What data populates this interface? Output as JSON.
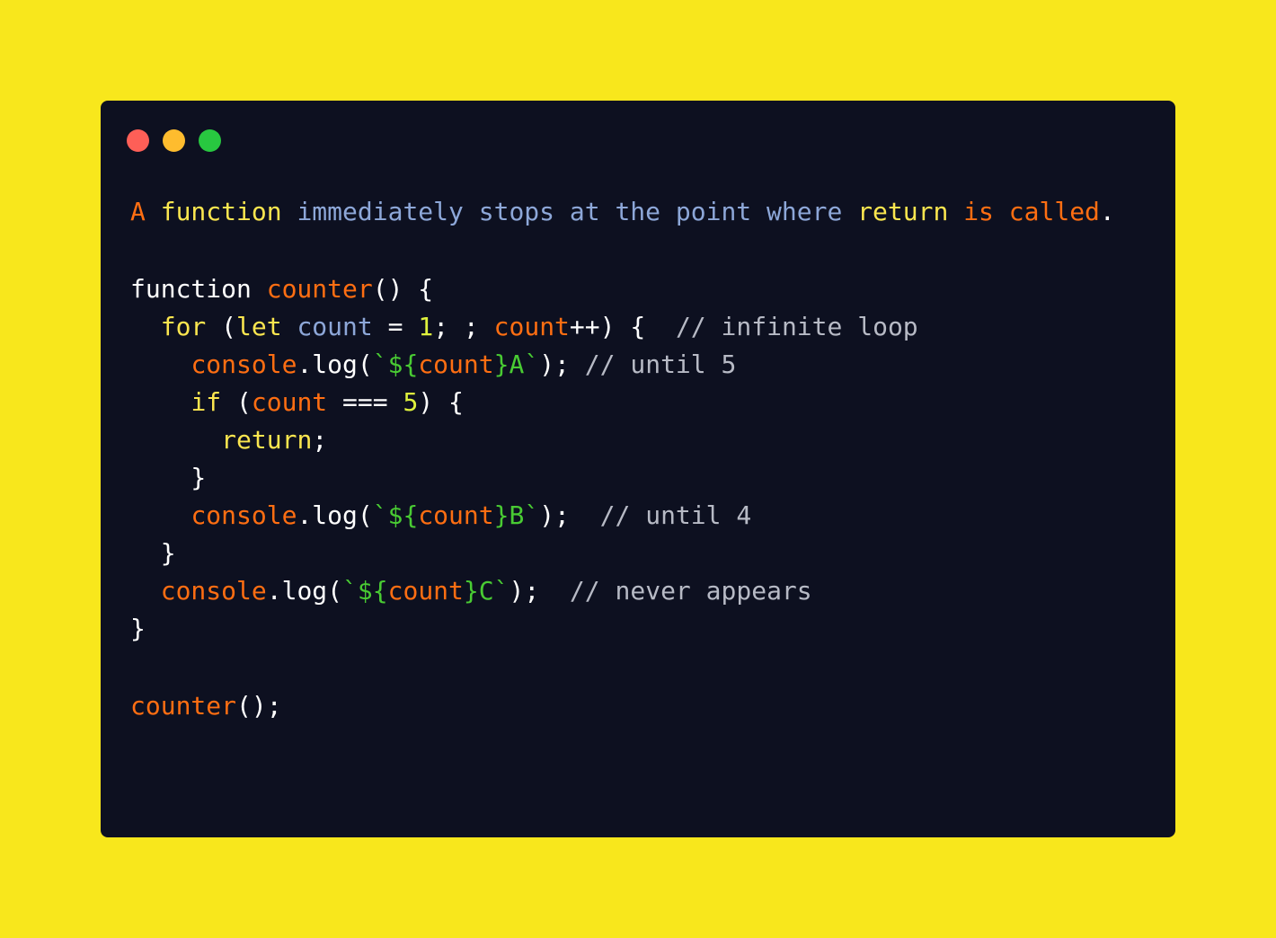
{
  "page": {
    "background_color": "#f8e71c"
  },
  "window": {
    "background_color": "#0d1020",
    "controls": [
      {
        "name": "close-button",
        "color": "#fe5f57"
      },
      {
        "name": "minimize-button",
        "color": "#febc2e"
      },
      {
        "name": "maximize-button",
        "color": "#28c840"
      }
    ]
  },
  "token_colors": {
    "plain": "#ffffff",
    "keyword": "#fbe64f",
    "ident": "#ff6e12",
    "name": "#8da7d8",
    "number": "#dff23d",
    "string": "#49cb33",
    "comment": "#b7bac5"
  },
  "code": {
    "lines": [
      {
        "gap_after": true,
        "tokens": [
          {
            "t": "A",
            "c": "ident"
          },
          {
            "t": " ",
            "c": "plain"
          },
          {
            "t": "function",
            "c": "keyword"
          },
          {
            "t": " ",
            "c": "plain"
          },
          {
            "t": "immediately stops at the point where",
            "c": "name"
          },
          {
            "t": " ",
            "c": "plain"
          },
          {
            "t": "return",
            "c": "keyword"
          },
          {
            "t": " ",
            "c": "plain"
          },
          {
            "t": "is called",
            "c": "ident"
          },
          {
            "t": ".",
            "c": "plain"
          }
        ]
      },
      {
        "tokens": [
          {
            "t": "function ",
            "c": "plain"
          },
          {
            "t": "counter",
            "c": "ident"
          },
          {
            "t": "() {",
            "c": "plain"
          }
        ]
      },
      {
        "tokens": [
          {
            "t": "  ",
            "c": "plain"
          },
          {
            "t": "for",
            "c": "keyword"
          },
          {
            "t": " (",
            "c": "plain"
          },
          {
            "t": "let",
            "c": "keyword"
          },
          {
            "t": " ",
            "c": "plain"
          },
          {
            "t": "count",
            "c": "name"
          },
          {
            "t": " = ",
            "c": "plain"
          },
          {
            "t": "1",
            "c": "number"
          },
          {
            "t": "; ; ",
            "c": "plain"
          },
          {
            "t": "count",
            "c": "ident"
          },
          {
            "t": "++) {  ",
            "c": "plain"
          },
          {
            "t": "// infinite loop",
            "c": "comment"
          }
        ]
      },
      {
        "tokens": [
          {
            "t": "    ",
            "c": "plain"
          },
          {
            "t": "console",
            "c": "ident"
          },
          {
            "t": ".log(",
            "c": "plain"
          },
          {
            "t": "`${",
            "c": "string"
          },
          {
            "t": "count",
            "c": "ident"
          },
          {
            "t": "}A`",
            "c": "string"
          },
          {
            "t": "); ",
            "c": "plain"
          },
          {
            "t": "// until 5",
            "c": "comment"
          }
        ]
      },
      {
        "tokens": [
          {
            "t": "    ",
            "c": "plain"
          },
          {
            "t": "if",
            "c": "keyword"
          },
          {
            "t": " (",
            "c": "plain"
          },
          {
            "t": "count",
            "c": "ident"
          },
          {
            "t": " === ",
            "c": "plain"
          },
          {
            "t": "5",
            "c": "number"
          },
          {
            "t": ") {",
            "c": "plain"
          }
        ]
      },
      {
        "tokens": [
          {
            "t": "      ",
            "c": "plain"
          },
          {
            "t": "return",
            "c": "keyword"
          },
          {
            "t": ";",
            "c": "plain"
          }
        ]
      },
      {
        "tokens": [
          {
            "t": "    }",
            "c": "plain"
          }
        ]
      },
      {
        "tokens": [
          {
            "t": "    ",
            "c": "plain"
          },
          {
            "t": "console",
            "c": "ident"
          },
          {
            "t": ".log(",
            "c": "plain"
          },
          {
            "t": "`${",
            "c": "string"
          },
          {
            "t": "count",
            "c": "ident"
          },
          {
            "t": "}B`",
            "c": "string"
          },
          {
            "t": ");  ",
            "c": "plain"
          },
          {
            "t": "// until 4",
            "c": "comment"
          }
        ]
      },
      {
        "tokens": [
          {
            "t": "  }",
            "c": "plain"
          }
        ]
      },
      {
        "tokens": [
          {
            "t": "  ",
            "c": "plain"
          },
          {
            "t": "console",
            "c": "ident"
          },
          {
            "t": ".log(",
            "c": "plain"
          },
          {
            "t": "`${",
            "c": "string"
          },
          {
            "t": "count",
            "c": "ident"
          },
          {
            "t": "}C`",
            "c": "string"
          },
          {
            "t": ");  ",
            "c": "plain"
          },
          {
            "t": "// never appears",
            "c": "comment"
          }
        ]
      },
      {
        "gap_after": true,
        "tokens": [
          {
            "t": "}",
            "c": "plain"
          }
        ]
      },
      {
        "tokens": [
          {
            "t": "counter",
            "c": "ident"
          },
          {
            "t": "();",
            "c": "plain"
          }
        ]
      }
    ]
  }
}
